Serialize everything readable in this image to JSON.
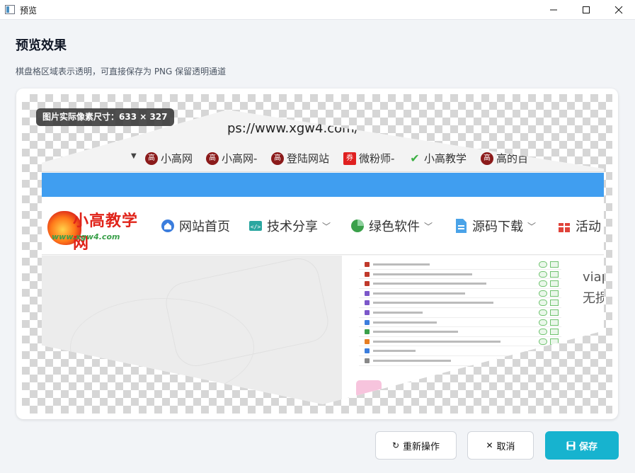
{
  "window": {
    "title": "预览"
  },
  "header": {
    "title": "预览效果",
    "subtitle": "棋盘格区域表示透明，可直接保存为 PNG 保留透明通道"
  },
  "preview": {
    "size_badge": "图片实际像素尺寸：633 × 327",
    "screenshot": {
      "url": "ps://www.xgw4.com/",
      "bookmarks": [
        "小高网",
        "小高网-",
        "登陆网站",
        "微粉师-",
        "小高教学",
        "高的百"
      ],
      "nav_items": [
        "网站首页",
        "技术分享",
        "绿色软件",
        "源码下载",
        "活动"
      ],
      "logo_text": "小高教学网",
      "logo_url": "www.xgw4.com",
      "side_text": [
        "viap",
        "无损"
      ]
    }
  },
  "actions": {
    "redo_label": "重新操作",
    "cancel_label": "取消",
    "save_label": "保存"
  },
  "colors": {
    "accent": "#17b3cf",
    "bluebar": "#409ef0"
  }
}
